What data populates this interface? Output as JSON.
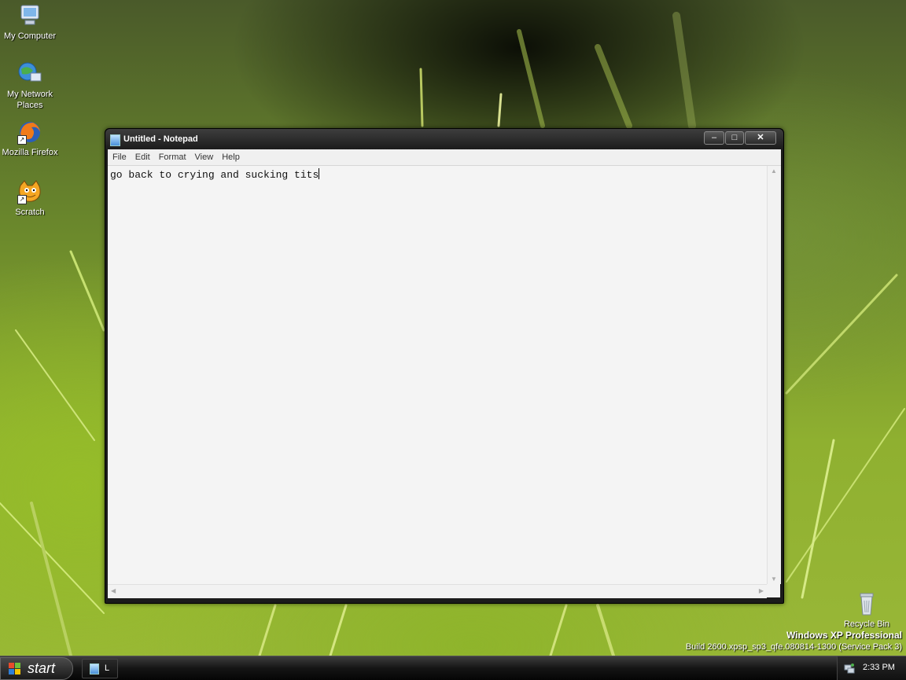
{
  "desktop": {
    "icons": [
      {
        "label": "My Computer",
        "icon": "computer-icon"
      },
      {
        "label": "My Network Places",
        "icon": "network-icon"
      },
      {
        "label": "Mozilla Firefox",
        "icon": "firefox-icon"
      },
      {
        "label": "Scratch",
        "icon": "scratch-cat-icon"
      },
      {
        "label": "Recycle Bin",
        "icon": "recycle-bin-icon"
      }
    ],
    "branding": {
      "product": "Windows XP Professional",
      "build": "Build 2600.xpsp_sp3_qfe.080814-1300 (Service Pack 3)"
    }
  },
  "notepad": {
    "title": "Untitled - Notepad",
    "menu": [
      "File",
      "Edit",
      "Format",
      "View",
      "Help"
    ],
    "text": "go back to crying and sucking tits",
    "controls": {
      "minimize": "–",
      "maximize": "□",
      "close": "✕"
    }
  },
  "taskbar": {
    "start_label": "start",
    "task_label": "L",
    "clock": "2:33 PM"
  }
}
